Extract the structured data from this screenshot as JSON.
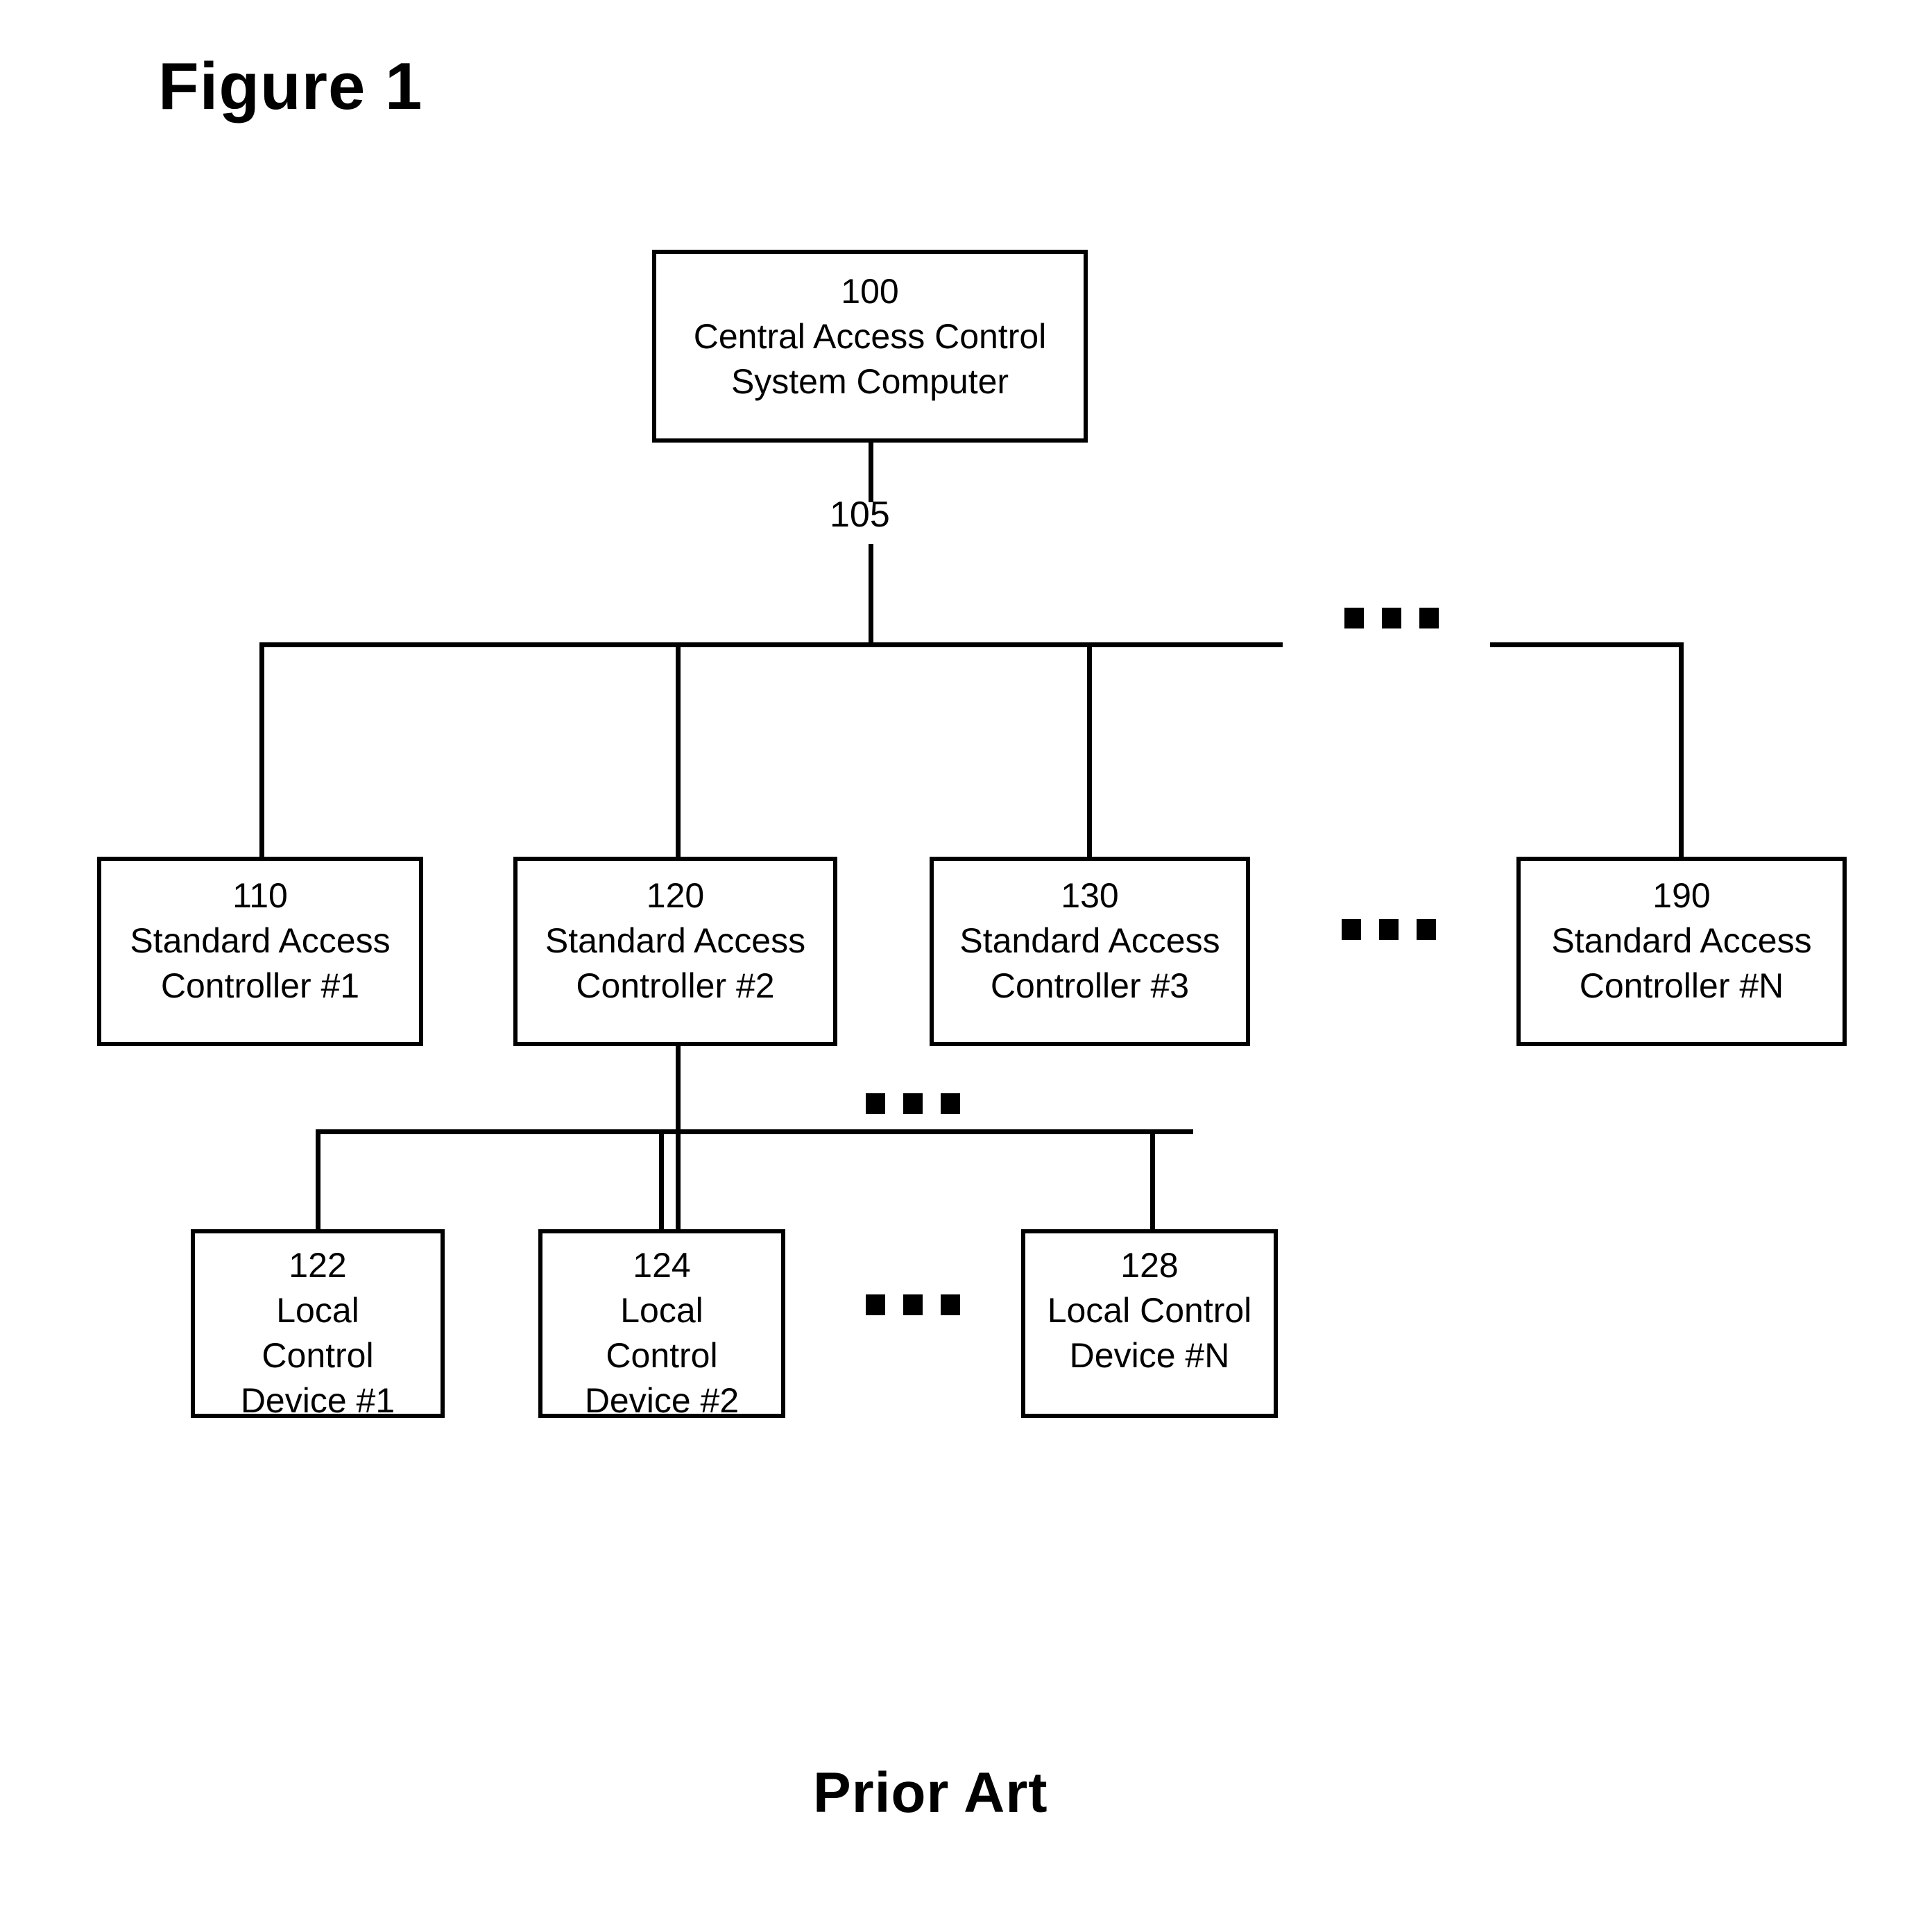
{
  "figure": {
    "title": "Figure 1",
    "footer": "Prior Art"
  },
  "diagram_data": {
    "type": "block-diagram",
    "nodes": [
      {
        "ref": "100",
        "lines": [
          "Central Access Control",
          "System Computer"
        ],
        "level": "central"
      },
      {
        "ref": "110",
        "lines": [
          "Standard Access",
          "Controller #1"
        ],
        "level": "controller"
      },
      {
        "ref": "120",
        "lines": [
          "Standard Access",
          "Controller #2"
        ],
        "level": "controller"
      },
      {
        "ref": "130",
        "lines": [
          "Standard Access",
          "Controller #3"
        ],
        "level": "controller"
      },
      {
        "ref": "190",
        "lines": [
          "Standard Access",
          "Controller #N"
        ],
        "level": "controller"
      },
      {
        "ref": "122",
        "lines": [
          "Local",
          "Control",
          "Device #1"
        ],
        "level": "device"
      },
      {
        "ref": "124",
        "lines": [
          "Local",
          "Control",
          "Device #2"
        ],
        "level": "device"
      },
      {
        "ref": "128",
        "lines": [
          "Local Control",
          "Device #N"
        ],
        "level": "device"
      }
    ],
    "edge_labels": [
      {
        "ref": "105",
        "description": "bus between central computer and controllers"
      }
    ],
    "continuation_marks": 4,
    "stroke_color": "#000000",
    "background_color": "#ffffff"
  },
  "boxes": {
    "n100": {
      "ref": "100",
      "l1": "Central Access Control",
      "l2": "System Computer"
    },
    "n110": {
      "ref": "110",
      "l1": "Standard Access",
      "l2": "Controller #1"
    },
    "n120": {
      "ref": "120",
      "l1": "Standard Access",
      "l2": "Controller #2"
    },
    "n130": {
      "ref": "130",
      "l1": "Standard Access",
      "l2": "Controller #3"
    },
    "n190": {
      "ref": "190",
      "l1": "Standard Access",
      "l2": "Controller #N"
    },
    "n122": {
      "ref": "122",
      "l1": "Local",
      "l2": "Control",
      "l3": "Device #1"
    },
    "n124": {
      "ref": "124",
      "l1": "Local",
      "l2": "Control",
      "l3": "Device #2"
    },
    "n128": {
      "ref": "128",
      "l1": "Local Control",
      "l2": "Device #N"
    }
  },
  "labels": {
    "bus_105": "105"
  }
}
